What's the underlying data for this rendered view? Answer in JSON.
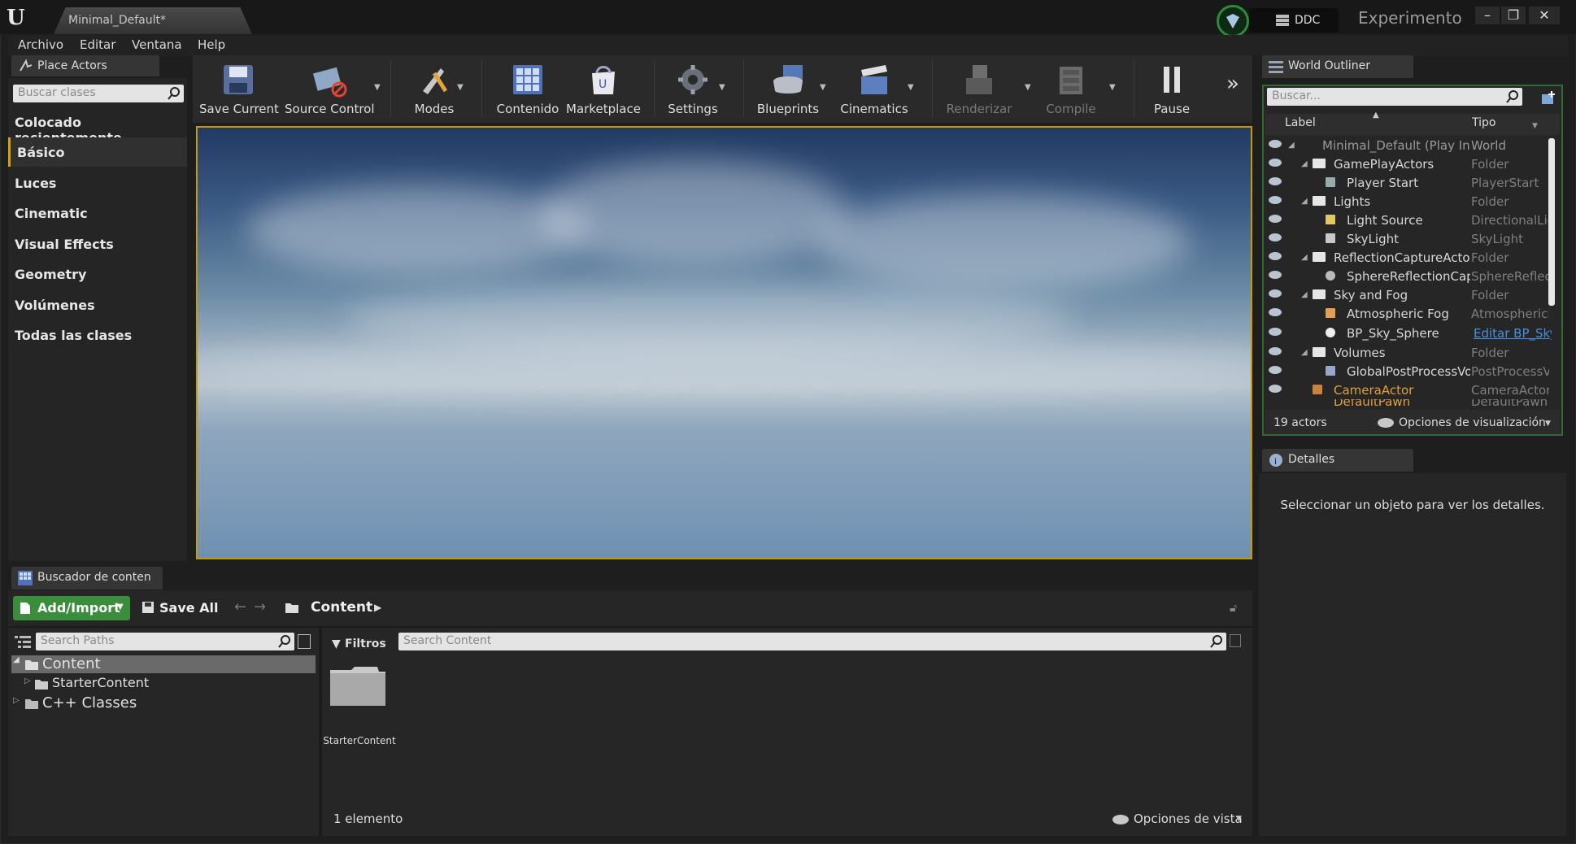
{
  "window": {
    "tab_title": "Minimal_Default*",
    "ddc_label": "DDC",
    "project_name": "Experimento",
    "minimize": "–",
    "restore": "❐",
    "close": "✕"
  },
  "menu": [
    "Archivo",
    "Editar",
    "Ventana",
    "Help"
  ],
  "place_actors": {
    "tab_label": "Place Actors",
    "search_placeholder": "Buscar clases",
    "categories": [
      "Colocado recientemente",
      "Básico",
      "Luces",
      "Cinematic",
      "Visual Effects",
      "Geometry",
      "Volúmenes",
      "Todas las clases"
    ],
    "selected": "Básico"
  },
  "toolbar": {
    "items": [
      {
        "label": "Save Current",
        "icon": "save-icon",
        "enabled": true
      },
      {
        "label": "Source Control",
        "icon": "source-control-icon",
        "enabled": true
      },
      {
        "label": "Modes",
        "icon": "modes-icon",
        "enabled": true
      },
      {
        "label": "Contenido",
        "icon": "content-icon",
        "enabled": true
      },
      {
        "label": "Marketplace",
        "icon": "marketplace-icon",
        "enabled": true
      },
      {
        "label": "Settings",
        "icon": "settings-icon",
        "enabled": true
      },
      {
        "label": "Blueprints",
        "icon": "blueprints-icon",
        "enabled": true
      },
      {
        "label": "Cinematics",
        "icon": "cinematics-icon",
        "enabled": true
      },
      {
        "label": "Renderizar",
        "icon": "render-icon",
        "enabled": false
      },
      {
        "label": "Compile",
        "icon": "compile-icon",
        "enabled": false
      },
      {
        "label": "Pause",
        "icon": "pause-icon",
        "enabled": true
      }
    ],
    "overflow": "»"
  },
  "outliner": {
    "tab_label": "World Outliner",
    "search_placeholder": "Buscar...",
    "col_label": "Label",
    "col_type": "Tipo",
    "rows": [
      {
        "label": "Minimal_Default (Play In Editor)",
        "type": "World"
      },
      {
        "label": "GamePlayActors",
        "type": "Folder"
      },
      {
        "label": "Player Start",
        "type": "PlayerStart"
      },
      {
        "label": "Lights",
        "type": "Folder"
      },
      {
        "label": "Light Source",
        "type": "DirectionalLight"
      },
      {
        "label": "SkyLight",
        "type": "SkyLight"
      },
      {
        "label": "ReflectionCaptureActors",
        "type": "Folder"
      },
      {
        "label": "SphereReflectionCapture",
        "type": "SphereReflectionCapture"
      },
      {
        "label": "Sky and Fog",
        "type": "Folder"
      },
      {
        "label": "Atmospheric Fog",
        "type": "AtmosphericFog"
      },
      {
        "label": "BP_Sky_Sphere",
        "type": "Editar BP_Sky_Sphere"
      },
      {
        "label": "Volumes",
        "type": "Folder"
      },
      {
        "label": "GlobalPostProcessVolume",
        "type": "PostProcessVolume"
      },
      {
        "label": "CameraActor",
        "type": "CameraActor"
      },
      {
        "label": "DefaultPawn",
        "type": "DefaultPawn"
      }
    ],
    "actor_count": "19 actors",
    "view_options": "Opciones de visualización"
  },
  "details": {
    "tab_label": "Detalles",
    "empty_text": "Seleccionar un objeto para ver los detalles."
  },
  "content_browser": {
    "tab_label": "Buscador de contenido",
    "add_import": "Add/Import",
    "save_all": "Save All",
    "path_root": "Content",
    "search_paths_placeholder": "Search Paths",
    "filters": "Filtros",
    "search_content_placeholder": "Search Content",
    "tree": [
      "Content",
      "StarterContent",
      "C++ Classes"
    ],
    "assets": [
      {
        "name": "StarterContent"
      }
    ],
    "item_count": "1 elemento",
    "view_options": "Opciones de vista"
  },
  "colors": {
    "accent_orange": "#c99a00",
    "green": "#3a8d3a",
    "link_blue": "#4a8fdc"
  }
}
